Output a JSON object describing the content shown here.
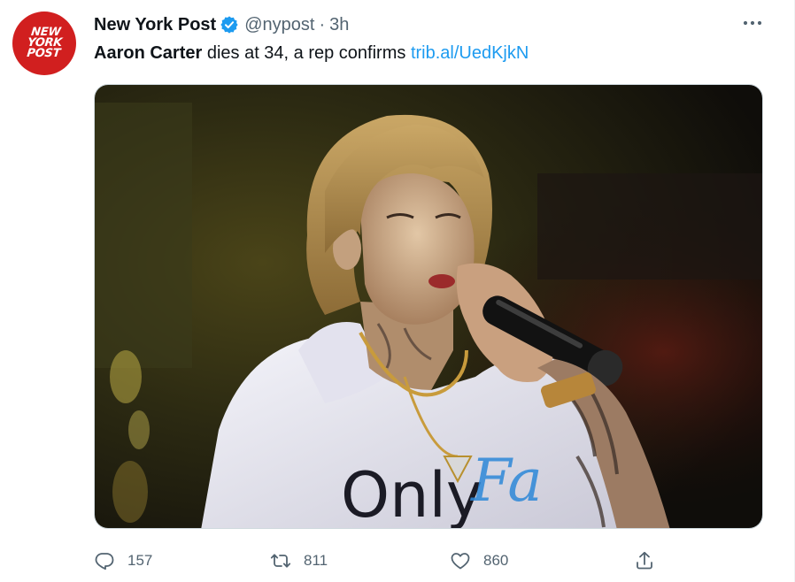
{
  "author": {
    "avatar_logo_lines": [
      "NEW",
      "YORK",
      "POST"
    ],
    "display_name": "New York Post",
    "handle": "@nypost",
    "separator": "·",
    "time": "3h"
  },
  "tweet": {
    "mention": "Aaron Carter",
    "text": " dies at 34, a rep confirms ",
    "link": "trib.al/UedKjkN"
  },
  "media": {
    "hoodie_text": "Only",
    "hoodie_script_text": "Fa"
  },
  "actions": {
    "replies": "157",
    "retweets": "811",
    "likes": "860"
  },
  "icons": {
    "verified": "verified-badge-icon",
    "more": "more-dots-icon",
    "reply": "reply-icon",
    "retweet": "retweet-icon",
    "like": "heart-icon",
    "share": "share-icon"
  },
  "colors": {
    "link": "#1d9bf0",
    "secondary_text": "#536471",
    "avatar_bg": "#d11f1f",
    "verified": "#1d9bf0"
  }
}
